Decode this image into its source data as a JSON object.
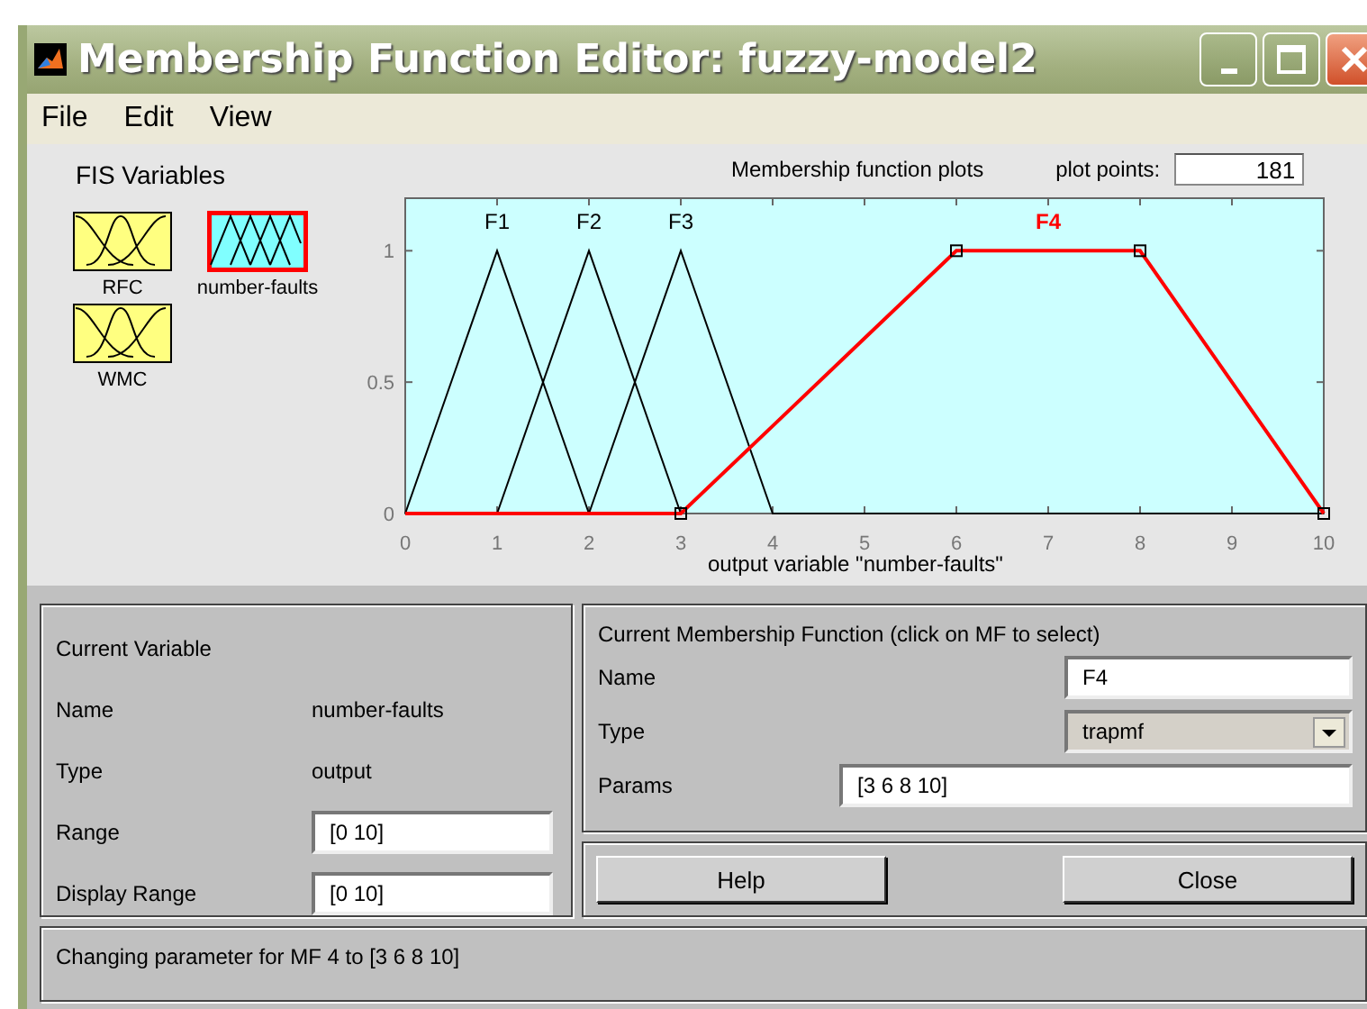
{
  "window": {
    "title": "Membership Function Editor: fuzzy-model2"
  },
  "menu": [
    "File",
    "Edit",
    "View"
  ],
  "fis_variables": {
    "title": "FIS Variables",
    "items": [
      {
        "name": "RFC",
        "kind": "input",
        "selected": false
      },
      {
        "name": "number-faults",
        "kind": "output",
        "selected": true
      },
      {
        "name": "WMC",
        "kind": "input",
        "selected": false
      }
    ]
  },
  "plot": {
    "plot_points_label": "plot points:",
    "plot_points": "181",
    "membership_functions": [
      {
        "selected": false
      },
      {
        "selected": false
      },
      {
        "selected": false
      },
      {
        "selected": true
      }
    ],
    "chart_data": {
      "type": "line",
      "title": "Membership function plots",
      "xlabel": "output variable \"number-faults\"",
      "x": [
        0,
        1,
        2,
        3,
        4,
        5,
        6,
        7,
        8,
        9,
        10
      ],
      "xlim": [
        0,
        10
      ],
      "ylim": [
        0,
        1.2
      ],
      "xticks": [
        0,
        1,
        2,
        3,
        4,
        5,
        6,
        7,
        8,
        9,
        10
      ],
      "yticks": [
        0,
        0.5,
        1
      ],
      "series": [
        {
          "name": "F1",
          "color": "#000000",
          "values": [
            0,
            1,
            0,
            null,
            null,
            null,
            null,
            null,
            null,
            null,
            null
          ]
        },
        {
          "name": "F2",
          "color": "#000000",
          "values": [
            null,
            0,
            1,
            0,
            null,
            null,
            null,
            null,
            null,
            null,
            null
          ]
        },
        {
          "name": "F3",
          "color": "#000000",
          "values": [
            null,
            null,
            0,
            1,
            0,
            0,
            0,
            0,
            0,
            0,
            0
          ]
        },
        {
          "name": "F4",
          "color": "#ff0000",
          "values": [
            0,
            0,
            0,
            0,
            0.333,
            0.667,
            1,
            1,
            1,
            0.5,
            0
          ]
        }
      ]
    }
  },
  "current_variable": {
    "title": "Current Variable",
    "name_label": "Name",
    "name": "number-faults",
    "type_label": "Type",
    "type": "output",
    "range_label": "Range",
    "range": "[0 10]",
    "display_range_label": "Display Range",
    "display_range": "[0 10]"
  },
  "current_mf": {
    "title": "Current Membership Function (click on MF to select)",
    "name_label": "Name",
    "name": "F4",
    "type_label": "Type",
    "type": "trapmf",
    "params_label": "Params",
    "params": "[3 6 8 10]"
  },
  "buttons": [
    "Help",
    "Close"
  ],
  "status": "Changing parameter for MF 4 to [3 6 8 10]"
}
